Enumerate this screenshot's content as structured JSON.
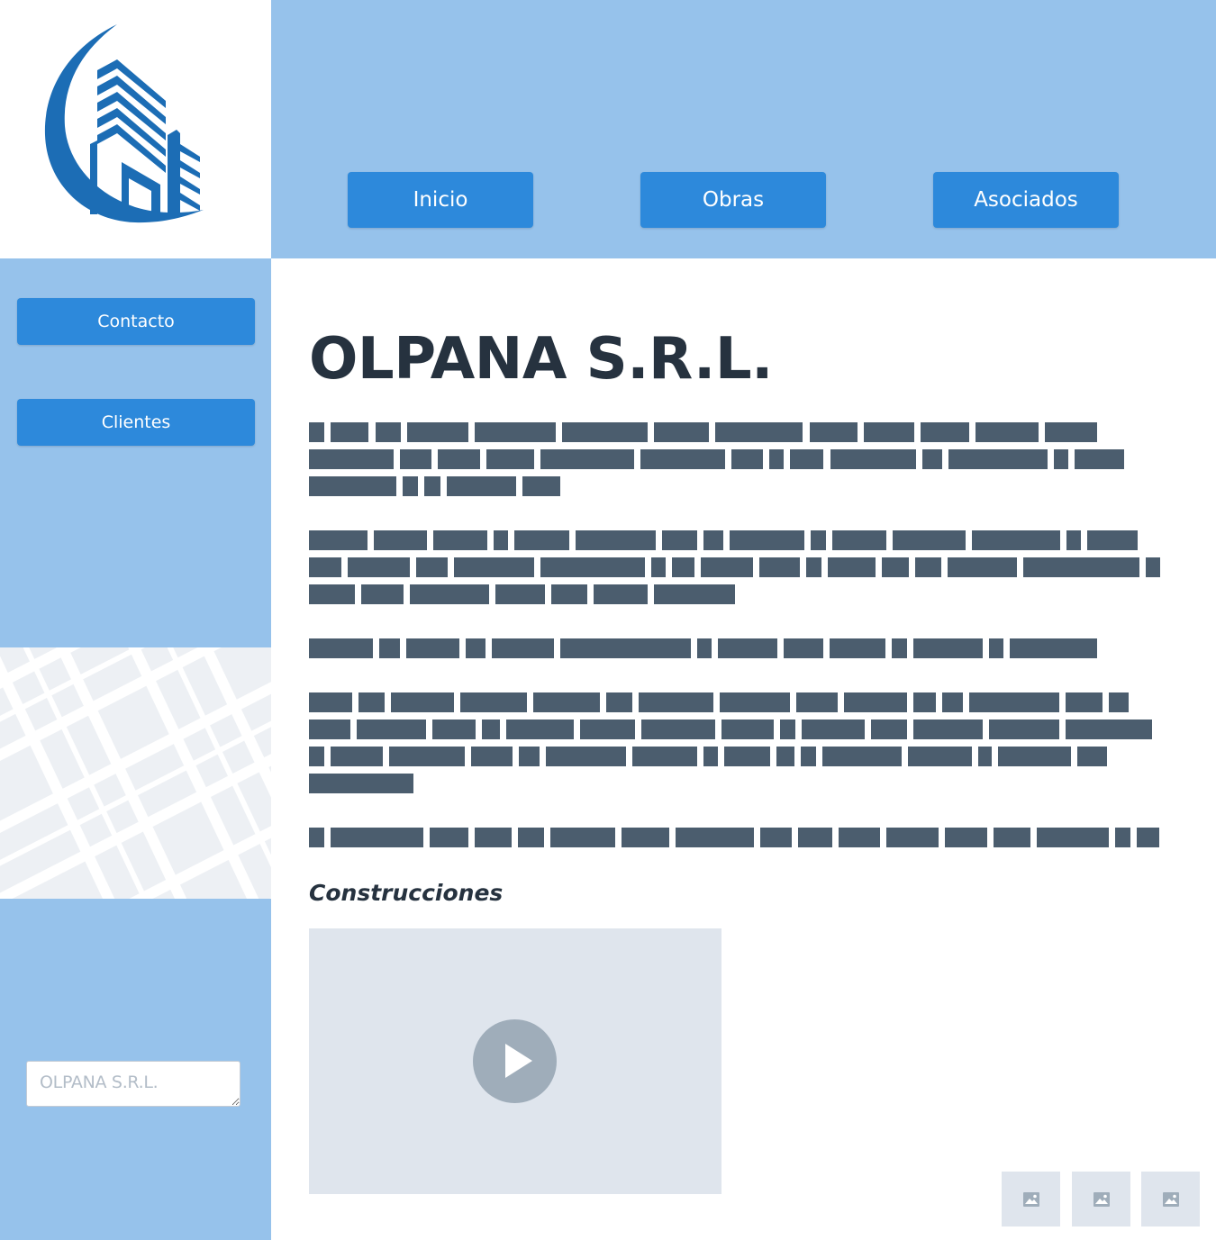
{
  "header": {
    "logo_name": "building-logo",
    "nav": [
      {
        "label": "Inicio"
      },
      {
        "label": "Obras"
      },
      {
        "label": "Asociados"
      }
    ]
  },
  "sidebar": {
    "buttons": [
      {
        "label": "Contacto"
      },
      {
        "label": "Clientes"
      }
    ],
    "textarea_value": "OLPANA S.R.L."
  },
  "main": {
    "title": "OLPANA S.R.L.",
    "subheading": "Construcciones"
  },
  "colors": {
    "header_band": "#96c2eb",
    "button": "#2d89db",
    "text_dark": "#26323f",
    "placeholder_text_block": "#4b5d6e",
    "media_placeholder": "#dfe5ed"
  },
  "icons": {
    "play": "play-icon",
    "image": "image-icon"
  }
}
